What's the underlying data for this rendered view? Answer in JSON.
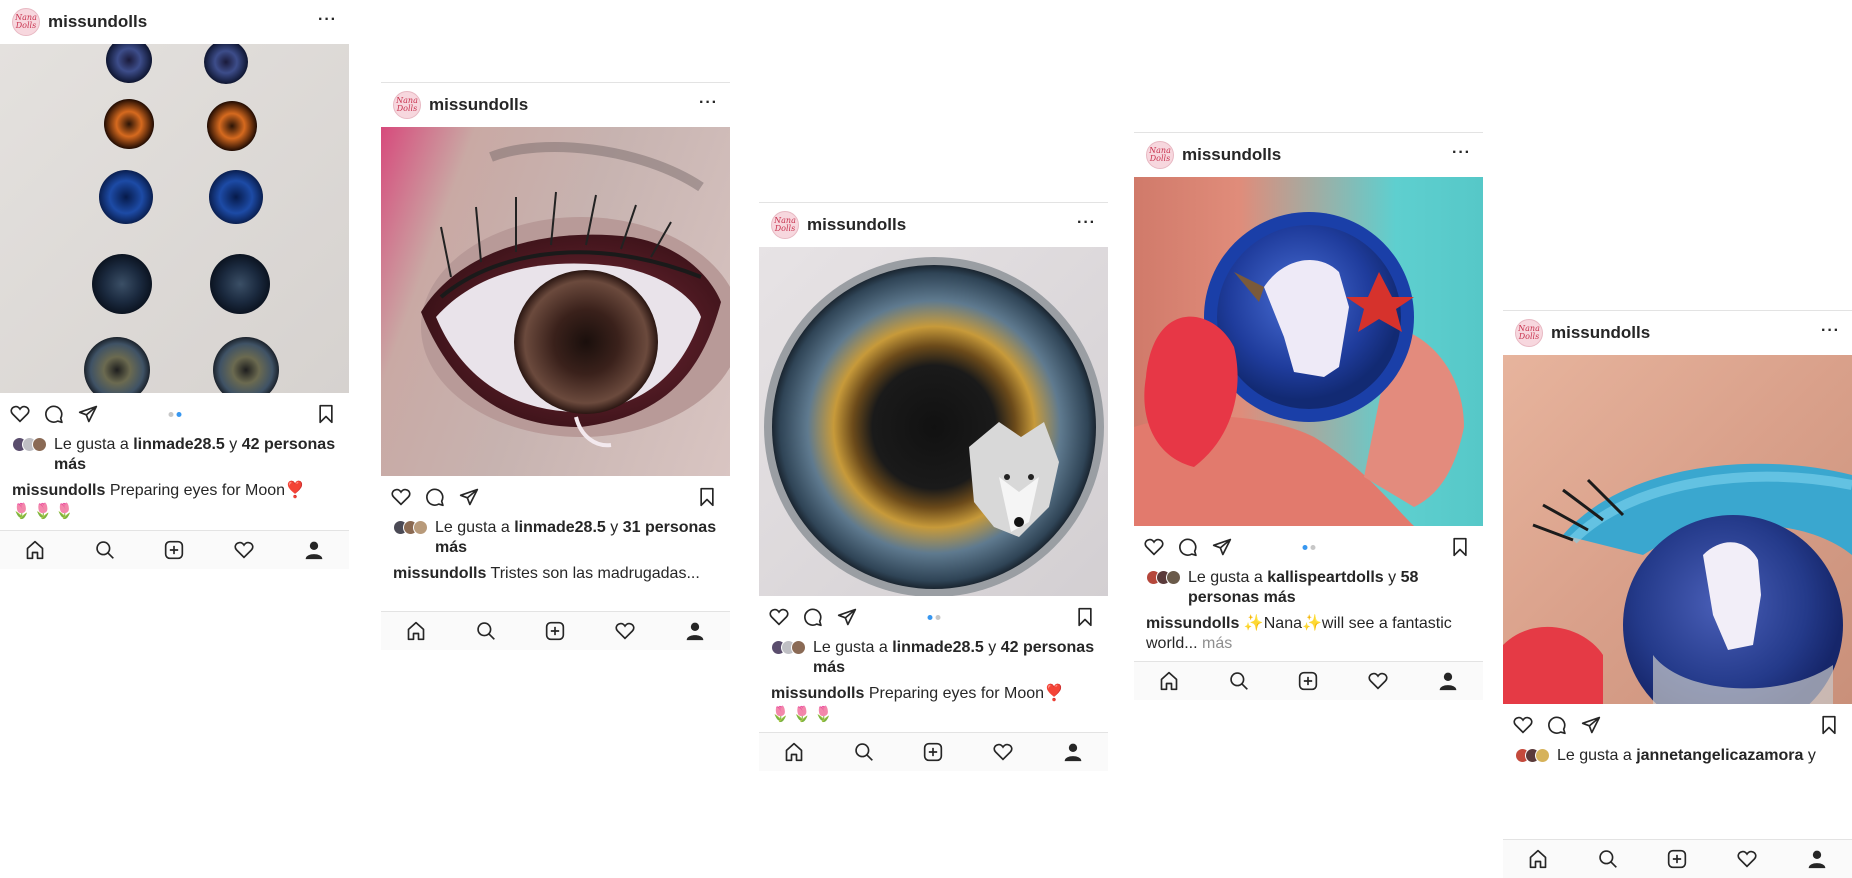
{
  "posts": [
    {
      "username": "missundolls",
      "avatar_text": "Nana Dolls",
      "liked_prefix": "Le gusta a",
      "liked_user": "linmade28.5",
      "liked_conj": "y",
      "liked_rest": "42 personas más",
      "caption_user": "missundolls",
      "caption_text": "Preparing eyes for Moon❣️",
      "caption_emojis": "🌷🌷🌷"
    },
    {
      "username": "missundolls",
      "avatar_text": "Nana Dolls",
      "liked_prefix": "Le gusta a",
      "liked_user": "linmade28.5",
      "liked_conj": "y",
      "liked_rest": "31 personas más",
      "caption_user": "missundolls",
      "caption_text": "Tristes son las madrugadas..."
    },
    {
      "username": "missundolls",
      "avatar_text": "Nana Dolls",
      "liked_prefix": "Le gusta a",
      "liked_user": "linmade28.5",
      "liked_conj": "y",
      "liked_rest": "42 personas más",
      "caption_user": "missundolls",
      "caption_text": "Preparing eyes for Moon❣️",
      "caption_emojis": "🌷🌷🌷"
    },
    {
      "username": "missundolls",
      "avatar_text": "Nana Dolls",
      "liked_prefix": "Le gusta a",
      "liked_user": "kallispeartdolls",
      "liked_conj": "y",
      "liked_rest": "58 personas más",
      "caption_user": "missundolls",
      "caption_text": "✨Nana✨will see a fantastic world...",
      "caption_more": "más"
    },
    {
      "username": "missundolls",
      "avatar_text": "Nana Dolls",
      "liked_prefix": "Le gusta a",
      "liked_user": "jannetangelicazamora",
      "liked_conj": "y"
    }
  ],
  "icons": {
    "header_more": "more-horizontal-icon",
    "actions": [
      "heart-icon",
      "comment-icon",
      "share-icon",
      "bookmark-icon"
    ],
    "bottom_nav": [
      "home-icon",
      "search-icon",
      "new-post-icon",
      "activity-heart-icon",
      "profile-icon"
    ]
  },
  "colors": {
    "carousel_active_dot": "#3897f0",
    "carousel_dot": "#c7c7c7",
    "text": "#262626",
    "muted": "#8e8e8e",
    "nav_bg": "#fafafa"
  }
}
